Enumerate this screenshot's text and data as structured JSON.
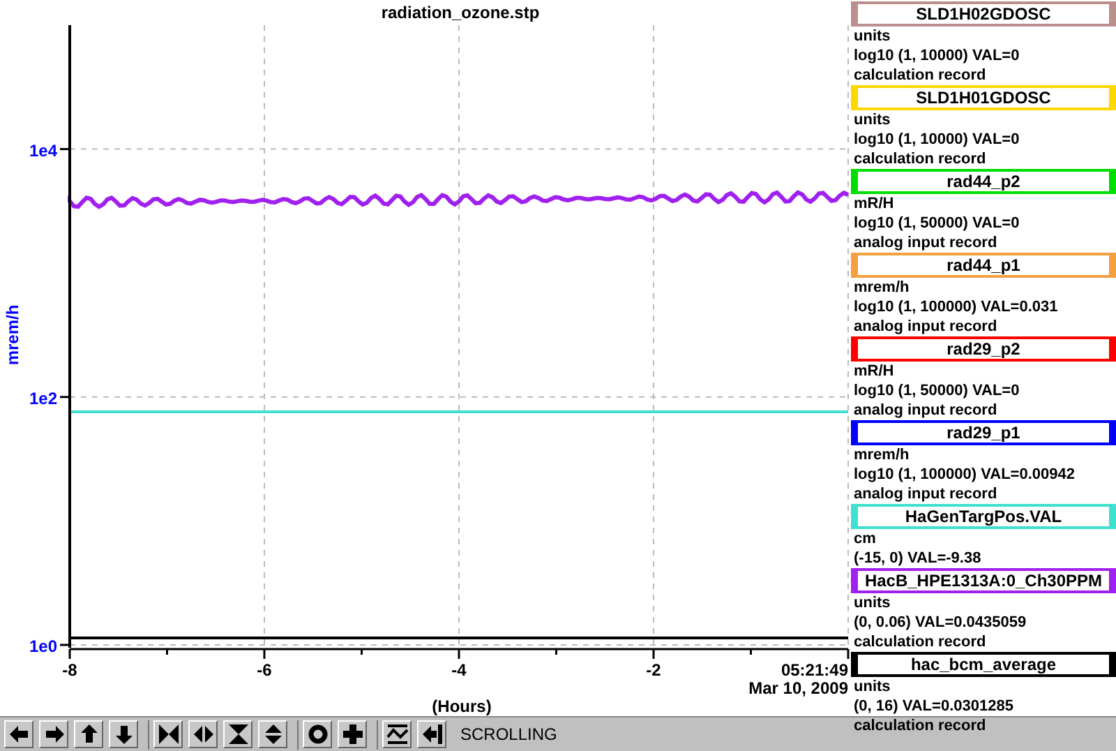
{
  "plot": {
    "title": "radiation_ozone.stp",
    "timestamp_time": "05:21:49",
    "timestamp_date": "Mar 10, 2009",
    "y_axis_title": "mrem/h",
    "x_axis_title": "(Hours)",
    "y_axis_labels": [
      "1e4",
      "1e2",
      "1e0"
    ],
    "x_axis_labels": [
      "-8",
      "-6",
      "-4",
      "-2"
    ],
    "traces": [
      {
        "color": "#a020f0",
        "kind": "noisy"
      },
      {
        "color": "#40e0d0",
        "kind": "flat"
      },
      {
        "color": "#000000",
        "kind": "flat"
      }
    ]
  },
  "legend": [
    {
      "name": "SLD1H02GDOSC",
      "color": "#bc8f8f",
      "units": "units",
      "range": "log10 (1, 10000) VAL=0",
      "record": "calculation record"
    },
    {
      "name": "SLD1H01GDOSC",
      "color": "#ffd700",
      "units": "units",
      "range": "log10 (1, 10000) VAL=0",
      "record": "calculation record"
    },
    {
      "name": "rad44_p2",
      "color": "#00dd00",
      "units": "mR/H",
      "range": "log10 (1, 50000) VAL=0",
      "record": "analog input record"
    },
    {
      "name": "rad44_p1",
      "color": "#f4a040",
      "units": "mrem/h",
      "range": "log10 (1, 100000) VAL=0.031",
      "record": "analog input record"
    },
    {
      "name": "rad29_p2",
      "color": "#ff0000",
      "units": "mR/H",
      "range": "log10 (1, 50000) VAL=0",
      "record": "analog input record"
    },
    {
      "name": "rad29_p1",
      "color": "#0000ff",
      "units": "mrem/h",
      "range": "log10 (1, 100000) VAL=0.00942",
      "record": "analog input record"
    },
    {
      "name": "HaGenTargPos.VAL",
      "color": "#40e0d0",
      "units": "cm",
      "range": "(-15, 0) VAL=-9.38"
    },
    {
      "name": "HacB_HPE1313A:0_Ch30PPM",
      "color": "#a020f0",
      "units": "units",
      "range": "(0, 0.06) VAL=0.0435059",
      "record": "calculation record"
    },
    {
      "name": "hac_bcm_average",
      "color": "#000000",
      "units": "units",
      "range": "(0, 16) VAL=0.0301285",
      "record": "calculation record"
    }
  ],
  "toolbar": {
    "mode": "SCROLLING"
  }
}
